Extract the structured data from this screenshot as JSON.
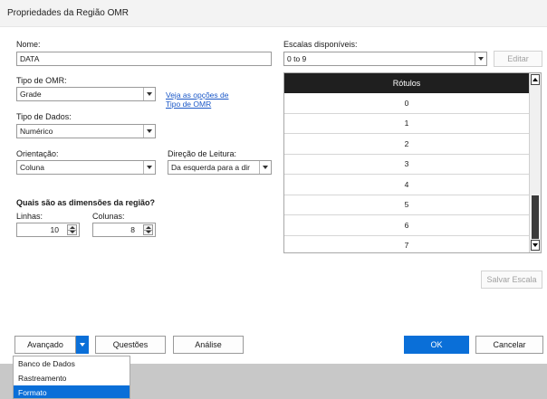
{
  "dialog": {
    "title": "Propriedades da Região OMR"
  },
  "name": {
    "label": "Nome:",
    "value": "DATA"
  },
  "scales": {
    "label": "Escalas disponíveis:",
    "selected": "0 to 9",
    "edit_label": "Editar",
    "column_header": "Rótulos",
    "rows": [
      "0",
      "1",
      "2",
      "3",
      "4",
      "5",
      "6",
      "7"
    ],
    "save_label": "Salvar Escala"
  },
  "omr_type": {
    "label": "Tipo de OMR:",
    "value": "Grade",
    "link_line1": "Veja as opções de",
    "link_line2": "Tipo de OMR"
  },
  "data_type": {
    "label": "Tipo de Dados:",
    "value": "Numérico"
  },
  "orientation": {
    "label": "Orientação:",
    "value": "Coluna"
  },
  "reading_direction": {
    "label": "Direção de Leitura:",
    "value": "Da esquerda para a dir"
  },
  "dimensions": {
    "heading": "Quais são as dimensões da região?",
    "rows_label": "Linhas:",
    "rows_value": "10",
    "cols_label": "Colunas:",
    "cols_value": "8"
  },
  "footer": {
    "advanced_label": "Avançado",
    "questions_label": "Questões",
    "analysis_label": "Análise",
    "ok_label": "OK",
    "cancel_label": "Cancelar"
  },
  "advanced_menu": {
    "items": [
      "Banco de Dados",
      "Rastreamento",
      "Formato"
    ],
    "selected_index": 2
  },
  "colors": {
    "accent": "#0a6fd8",
    "header_bg": "#1f1f1f"
  },
  "icons": {
    "dropdown": "chevron-down-icon",
    "spinner": "spinner-icon",
    "scroll_up": "scroll-up-icon",
    "scroll_down": "scroll-down-icon"
  }
}
